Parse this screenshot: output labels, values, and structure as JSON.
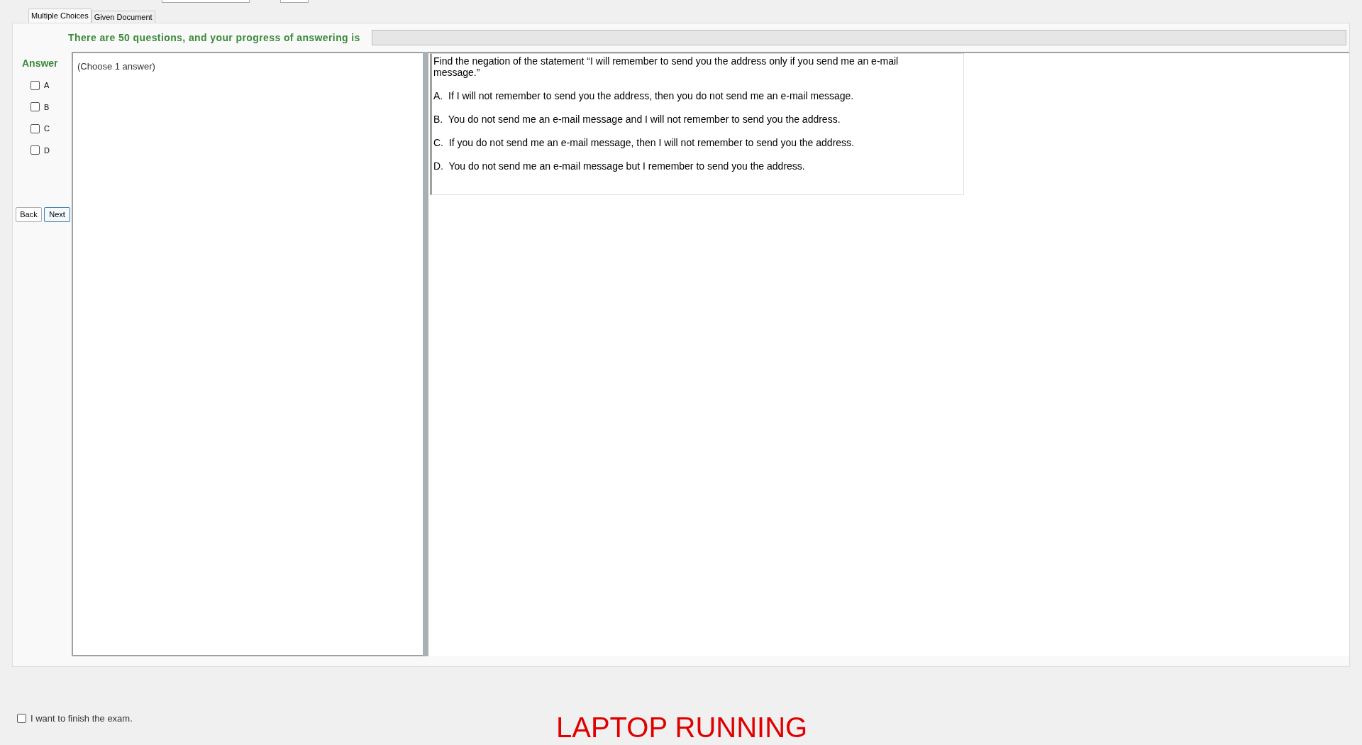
{
  "tabs": [
    {
      "label": "Multiple Choices",
      "selected": true
    },
    {
      "label": "Given Document",
      "selected": false
    }
  ],
  "progress": {
    "label": "There are 50 questions, and your progress of answering is",
    "level": 0
  },
  "answer": {
    "title": "Answer",
    "options": [
      {
        "label": "A",
        "checked": false
      },
      {
        "label": "B",
        "checked": false
      },
      {
        "label": "C",
        "checked": false
      },
      {
        "label": "D",
        "checked": false
      }
    ]
  },
  "nav_buttons": [
    {
      "label": "Back",
      "focused": false
    },
    {
      "label": "Next",
      "focused": true
    }
  ],
  "hint": "(Choose 1 answer)",
  "question": {
    "text": "Find the negation of the statement “I will remember to send you the address only if you send me an e-mail message.”",
    "choices": [
      "A.  If I will not remember to send you the address, then you do not send me an e-mail message.",
      "B.  You do not send me an e-mail message and I will not remember to send you the address.",
      "C.  If you do not send me an e-mail message, then I will not remember to send you the address.",
      "D.  You do not send me an e-mail message but I remember to send you the address."
    ]
  },
  "finish": {
    "label": "I want to finish the exam.",
    "checked": false
  },
  "status": "LAPTOP RUNNING"
}
